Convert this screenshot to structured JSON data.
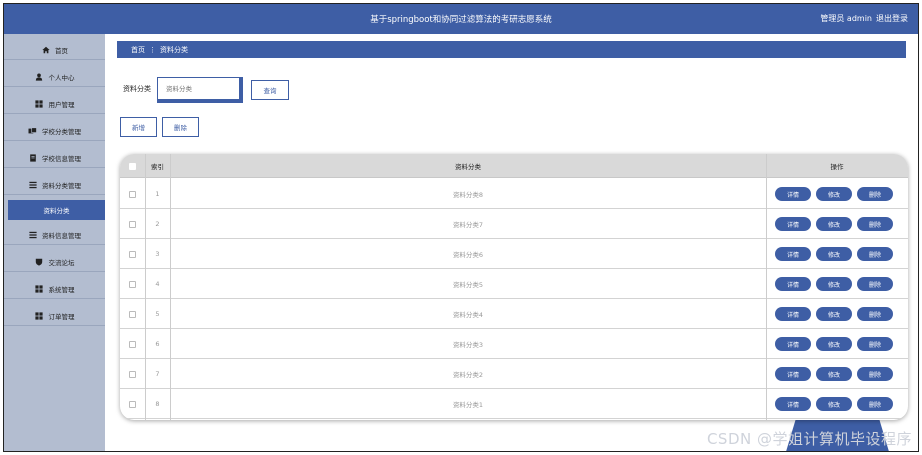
{
  "header": {
    "title": "基于springboot和协同过滤算法的考研志愿系统",
    "user_role": "管理员 admin",
    "logout_label": "退出登录"
  },
  "sidebar": {
    "items": [
      {
        "label": "首页",
        "icon": "home-icon"
      },
      {
        "label": "个人中心",
        "icon": "user-icon"
      },
      {
        "label": "用户管理",
        "icon": "grid-icon"
      },
      {
        "label": "学校分类管理",
        "icon": "cards-icon"
      },
      {
        "label": "学校信息管理",
        "icon": "doc-icon"
      },
      {
        "label": "资料分类管理",
        "icon": "list-icon"
      },
      {
        "label": "资料分类",
        "icon": "",
        "active": true
      },
      {
        "label": "资料信息管理",
        "icon": "list-icon"
      },
      {
        "label": "交流论坛",
        "icon": "shield-icon"
      },
      {
        "label": "系统管理",
        "icon": "grid-icon"
      },
      {
        "label": "订单管理",
        "icon": "grid-icon"
      }
    ]
  },
  "breadcrumb": {
    "home": "首页",
    "separator": "⋮",
    "current": "资料分类"
  },
  "search": {
    "label": "资料分类",
    "placeholder": "资料分类",
    "query_label": "查询"
  },
  "toolbar": {
    "add_label": "新增",
    "delete_label": "删除"
  },
  "table": {
    "columns": {
      "index": "索引",
      "category": "资料分类",
      "actions": "操作"
    },
    "action_labels": {
      "detail": "详情",
      "edit": "修改",
      "delete": "删除"
    },
    "rows": [
      {
        "index": "1",
        "category": "资料分类8"
      },
      {
        "index": "2",
        "category": "资料分类7"
      },
      {
        "index": "3",
        "category": "资料分类6"
      },
      {
        "index": "4",
        "category": "资料分类5"
      },
      {
        "index": "5",
        "category": "资料分类4"
      },
      {
        "index": "6",
        "category": "资料分类3"
      },
      {
        "index": "7",
        "category": "资料分类2"
      },
      {
        "index": "8",
        "category": "资料分类1"
      }
    ]
  },
  "watermark": "CSDN @学姐计算机毕设程序",
  "colors": {
    "primary": "#3e5ea5",
    "sidebar": "#b3bdd0",
    "table_header": "#d9d9d9"
  }
}
